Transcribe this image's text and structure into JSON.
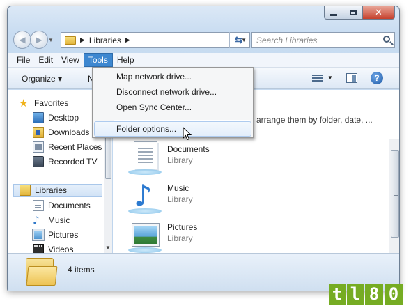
{
  "window": {
    "caption_buttons": {
      "minimize": "minimize",
      "maximize": "maximize",
      "close": "✕"
    }
  },
  "navbar": {
    "back": "◀",
    "forward": "▶",
    "address_breadcrumb": [
      "Libraries"
    ],
    "search_placeholder": "Search Libraries"
  },
  "menubar": {
    "items": [
      {
        "label": "File",
        "active": false
      },
      {
        "label": "Edit",
        "active": false
      },
      {
        "label": "View",
        "active": false
      },
      {
        "label": "Tools",
        "active": true
      },
      {
        "label": "Help",
        "active": false
      }
    ]
  },
  "toolbar": {
    "organize_label": "Organize ▾",
    "partial_label": "N"
  },
  "tools_menu": {
    "items": [
      {
        "label": "Map network drive...",
        "hover": false
      },
      {
        "label": "Disconnect network drive...",
        "hover": false
      },
      {
        "label": "Open Sync Center...",
        "hover": false
      },
      {
        "label": "Folder options...",
        "hover": true
      }
    ]
  },
  "nav_pane": {
    "favorites_label": "Favorites",
    "favorites": [
      {
        "label": "Desktop",
        "icon": "desktop-icon"
      },
      {
        "label": "Downloads",
        "icon": "downloads-icon"
      },
      {
        "label": "Recent Places",
        "icon": "recent-places-icon"
      },
      {
        "label": "Recorded TV",
        "icon": "recorded-tv-icon"
      }
    ],
    "libraries_label": "Libraries",
    "libraries": [
      {
        "label": "Documents",
        "icon": "documents-icon"
      },
      {
        "label": "Music",
        "icon": "music-icon"
      },
      {
        "label": "Pictures",
        "icon": "pictures-icon"
      },
      {
        "label": "Videos",
        "icon": "videos-icon"
      }
    ]
  },
  "content": {
    "heading_partial": "arrange them by folder, date, ...",
    "items": [
      {
        "name": "Documents",
        "type": "Library",
        "icon": "documents-library-icon"
      },
      {
        "name": "Music",
        "type": "Library",
        "icon": "music-library-icon"
      },
      {
        "name": "Pictures",
        "type": "Library",
        "icon": "pictures-library-icon"
      }
    ]
  },
  "status": {
    "count_text": "4 items"
  },
  "watermark": {
    "text": [
      "t",
      "l",
      "8",
      "0"
    ]
  },
  "colors": {
    "menu_active": "#3d87d0",
    "watermark_green": "#76ac23"
  }
}
